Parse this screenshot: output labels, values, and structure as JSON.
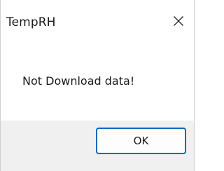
{
  "window": {
    "title": "TempRH"
  },
  "titlebar": {
    "close_icon": "close-icon"
  },
  "dialog": {
    "message": "Not Download data!"
  },
  "buttons": {
    "ok_label": "OK"
  },
  "colors": {
    "accent": "#0067c0",
    "footer_background": "#f0f0f0",
    "content_background": "#ffffff"
  }
}
